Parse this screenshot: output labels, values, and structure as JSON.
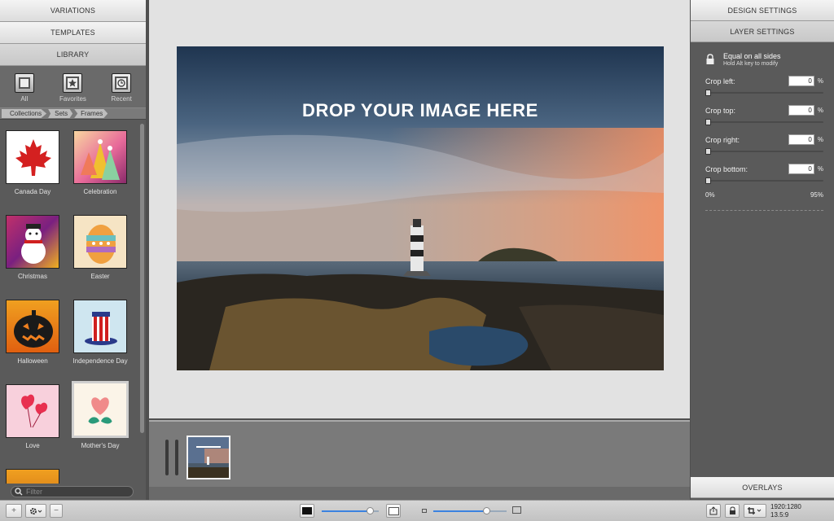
{
  "left": {
    "buttons": [
      "VARIATIONS",
      "TEMPLATES",
      "LIBRARY"
    ],
    "library_filters": [
      {
        "label": "All",
        "icon": "square-icon"
      },
      {
        "label": "Favorites",
        "icon": "star-icon"
      },
      {
        "label": "Recent",
        "icon": "clock-icon"
      }
    ],
    "breadcrumbs": [
      "Collections",
      "Sets",
      "Frames"
    ],
    "items": [
      {
        "label": "Canada Day",
        "icon": "maple-leaf-icon"
      },
      {
        "label": "Celebration",
        "icon": "party-hats-icon"
      },
      {
        "label": "Christmas",
        "icon": "snowman-icon"
      },
      {
        "label": "Easter",
        "icon": "easter-egg-icon"
      },
      {
        "label": "Halloween",
        "icon": "pumpkin-icon"
      },
      {
        "label": "Independence Day",
        "icon": "uncle-sam-hat-icon"
      },
      {
        "label": "Love",
        "icon": "heart-balloons-icon"
      },
      {
        "label": "Mother's Day",
        "icon": "heart-leaves-icon"
      }
    ],
    "selected_item": "Mother's Day",
    "filter_placeholder": "Filter"
  },
  "canvas": {
    "drop_text": "DROP YOUR IMAGE HERE"
  },
  "right": {
    "buttons": [
      "DESIGN SETTINGS",
      "LAYER SETTINGS"
    ],
    "equal_sides": {
      "label": "Equal on all sides",
      "hint": "Hold Alt key to modify"
    },
    "crops": [
      {
        "label": "Crop left:",
        "value": "0",
        "unit": "%",
        "level": 0
      },
      {
        "label": "Crop top:",
        "value": "0",
        "unit": "%",
        "level": 0
      },
      {
        "label": "Crop right:",
        "value": "0",
        "unit": "%",
        "level": 0
      },
      {
        "label": "Crop bottom:",
        "value": "0",
        "unit": "%",
        "level": 0
      }
    ],
    "range_min": "0%",
    "range_max": "95%",
    "overlays_label": "OVERLAYS"
  },
  "bottom": {
    "dimensions": "1920:1280",
    "ratio": "13.5:9",
    "zoom_level": 0.9,
    "thumb_size_level": 0.75
  },
  "colors": {
    "accent": "#3b82e0",
    "panel": "#5a5a5a",
    "canvas_bg": "#e2e2e2"
  }
}
